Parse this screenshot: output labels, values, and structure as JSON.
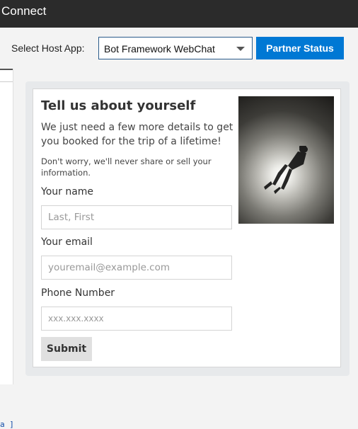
{
  "window": {
    "title": "Connect"
  },
  "toolbar": {
    "host_label": "Select Host App:",
    "host_selected": "Bot Framework WebChat",
    "partner_button": "Partner Status"
  },
  "left_pane": {
    "code_fragment": "a ]"
  },
  "card": {
    "title": "Tell us about yourself",
    "subtitle": "We just need a few more details to get you booked for the trip of a lifetime!",
    "privacy_note": "Don't worry, we'll never share or sell your information.",
    "fields": [
      {
        "label": "Your name",
        "placeholder": "Last, First"
      },
      {
        "label": "Your email",
        "placeholder": "youremail@example.com"
      },
      {
        "label": "Phone Number",
        "placeholder": "xxx.xxx.xxxx"
      }
    ],
    "submit_label": "Submit",
    "image_icon": "scuba-diver-image"
  },
  "colors": {
    "titlebar": "#2b2b2b",
    "accent": "#0078d4",
    "select_border": "#2a5b8a"
  }
}
